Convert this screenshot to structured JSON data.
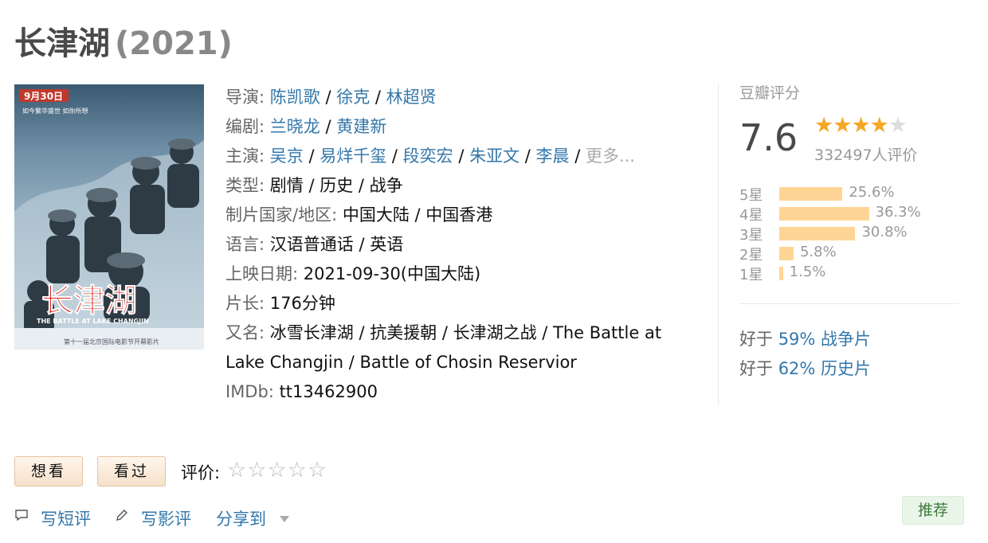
{
  "movie": {
    "title": "长津湖",
    "year": "(2021)"
  },
  "poster": {
    "date_text": "9月30日",
    "tagline": "如今繁华盛世 如你所想",
    "big_title": "长津湖",
    "subtitle": "THE BATTLE AT LAKE CHANGJIN",
    "festival_text": "第十一届北京国际电影节开幕影片"
  },
  "info": {
    "director_label": "导演",
    "directors": [
      "陈凯歌",
      "徐克",
      "林超贤"
    ],
    "writer_label": "编剧",
    "writers": [
      "兰晓龙",
      "黄建新"
    ],
    "cast_label": "主演",
    "cast": [
      "吴京",
      "易烊千玺",
      "段奕宏",
      "朱亚文",
      "李晨"
    ],
    "cast_more": "更多...",
    "genre_label": "类型:",
    "genres": "剧情 / 历史 / 战争",
    "country_label": "制片国家/地区:",
    "country": "中国大陆 / 中国香港",
    "language_label": "语言:",
    "language": "汉语普通话 / 英语",
    "release_label": "上映日期:",
    "release": "2021-09-30(中国大陆)",
    "runtime_label": "片长:",
    "runtime": "176分钟",
    "aka_label": "又名:",
    "aka": "冰雪长津湖 / 抗美援朝 / 长津湖之战 / The Battle at Lake Changjin / Battle of Chosin Reservior",
    "imdb_label": "IMDb:",
    "imdb": "tt13462900"
  },
  "rating": {
    "title": "豆瓣评分",
    "score": "7.6",
    "stars_filled": 4,
    "stars_total": 5,
    "count_text": "332497人评价",
    "bars": [
      {
        "label": "5星",
        "pct": "25.6%",
        "value": 25.6
      },
      {
        "label": "4星",
        "pct": "36.3%",
        "value": 36.3
      },
      {
        "label": "3星",
        "pct": "30.8%",
        "value": 30.8
      },
      {
        "label": "2星",
        "pct": "5.8%",
        "value": 5.8
      },
      {
        "label": "1星",
        "pct": "1.5%",
        "value": 1.5
      }
    ],
    "better_than": [
      {
        "prefix": "好于",
        "link": "59% 战争片"
      },
      {
        "prefix": "好于",
        "link": "62% 历史片"
      }
    ]
  },
  "actions": {
    "want_label": "想看",
    "seen_label": "看过",
    "rate_label": "评价:",
    "rate_stars": "☆☆☆☆☆",
    "short_review": "写短评",
    "long_review": "写影评",
    "share": "分享到",
    "recommend": "推荐"
  },
  "icons": {
    "comment": "comment-icon",
    "pen": "pen-icon",
    "dropdown": "caret-down-icon"
  },
  "colors": {
    "link": "#3377aa",
    "star": "#f6a623",
    "bar": "#ffd596"
  }
}
